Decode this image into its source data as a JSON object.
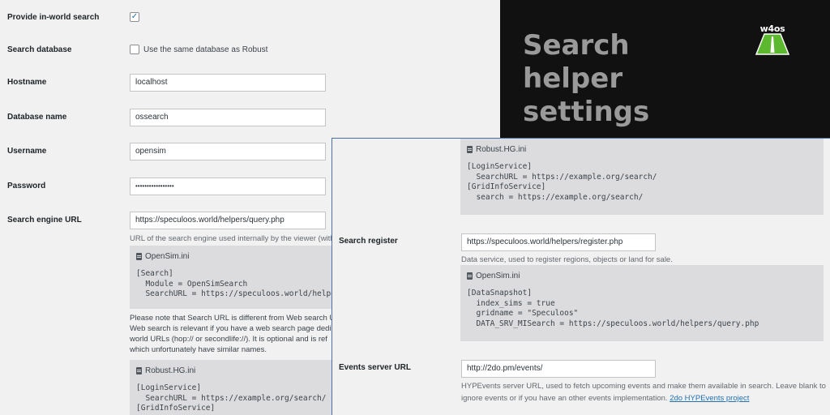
{
  "left": {
    "provide_search": {
      "label": "Provide in-world search",
      "checked": "✓"
    },
    "search_database": {
      "label": "Search database",
      "checkbox_label": "Use the same database as Robust"
    },
    "hostname": {
      "label": "Hostname",
      "value": "localhost"
    },
    "database_name": {
      "label": "Database name",
      "value": "ossearch"
    },
    "username": {
      "label": "Username",
      "value": "opensim"
    },
    "password": {
      "label": "Password",
      "value": "•••••••••••••••••"
    },
    "search_engine_url": {
      "label": "Search engine URL",
      "value": "https://speculoos.world/helpers/query.php",
      "description": "URL of the search engine used internally by the viewer (with"
    },
    "opensim_ini": {
      "filename": "OpenSim.ini",
      "code": "[Search]\n  Module = OpenSimSearch\n  SearchURL = https://speculoos.world/helpers"
    },
    "note": [
      "Please note that Search URL is different from Web search U",
      "Web search is relevant if you have a web search page dedic",
      "world URLs (hop:// or secondlife://). It is optional and is ref",
      "which unfortunately have similar names."
    ],
    "robust_ini": {
      "filename": "Robust.HG.ini",
      "code": "[LoginService]\n  SearchURL = https://example.org/search/\n[GridInfoService]"
    }
  },
  "header": {
    "title_lines": [
      "Search",
      "helper",
      "settings"
    ],
    "logo_text": "w4os"
  },
  "overlay": {
    "robust_ini": {
      "filename": "Robust.HG.ini",
      "code": "[LoginService]\n  SearchURL = https://example.org/search/\n[GridInfoService]\n  search = https://example.org/search/"
    },
    "search_register": {
      "label": "Search register",
      "value": "https://speculoos.world/helpers/register.php",
      "description": "Data service, used to register regions, objects or land for sale."
    },
    "opensim_ini": {
      "filename": "OpenSim.ini",
      "code": "[DataSnapshot]\n  index_sims = true\n  gridname = \"Speculoos\"\n  DATA_SRV_MISearch = https://speculoos.world/helpers/query.php"
    },
    "events_server_url": {
      "label": "Events server URL",
      "value": "http://2do.pm/events/",
      "description_line1": "HYPEvents server URL, used to fetch upcoming events and make them available in search. Leave blank to",
      "description_line2": "ignore events or if you have an other events implementation.",
      "link_text": "2do HYPEvents project"
    }
  },
  "colors": {
    "accent": "#2271b1",
    "dark_bg": "#111111",
    "logo_green": "#5cb82e"
  }
}
